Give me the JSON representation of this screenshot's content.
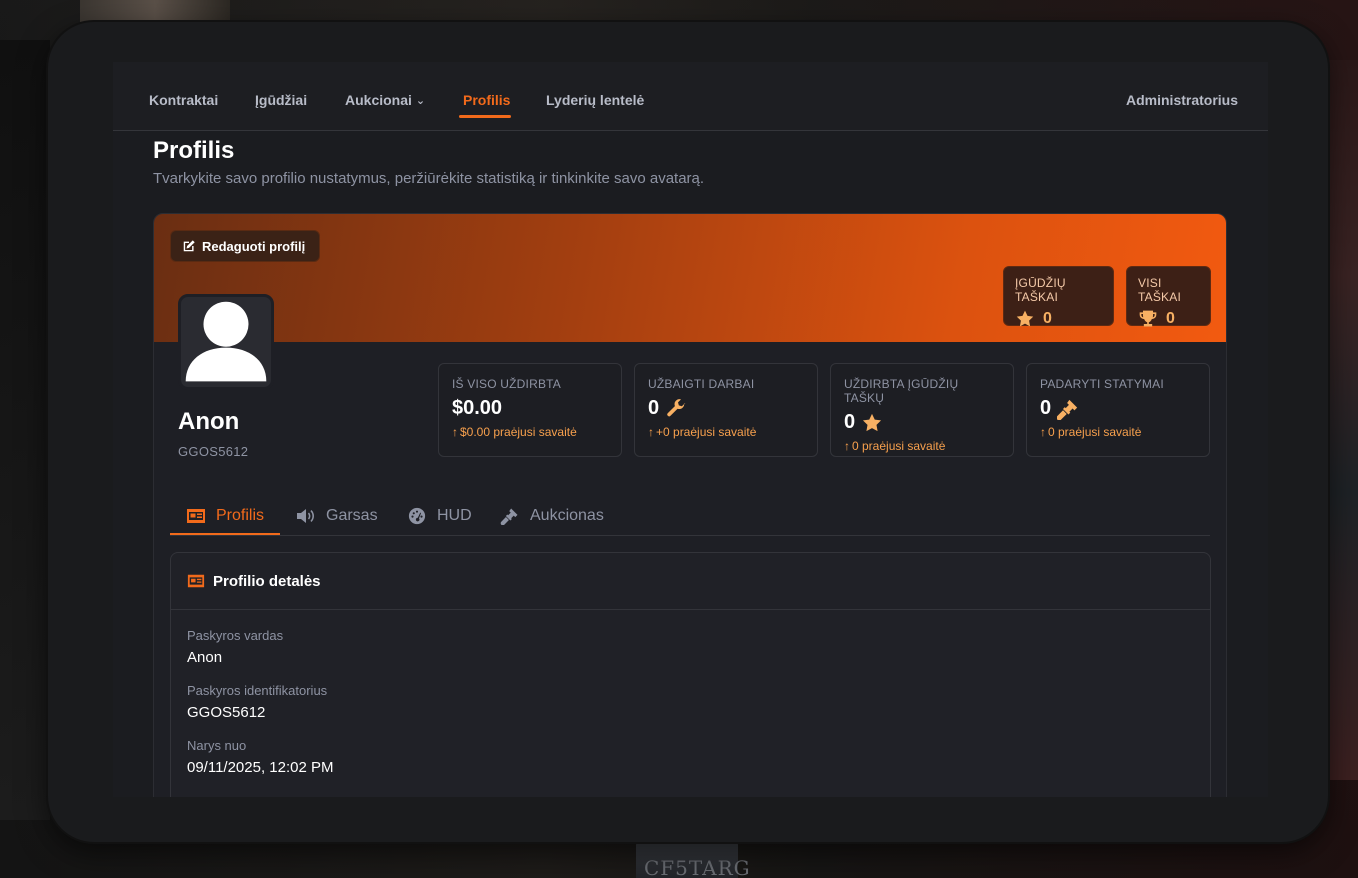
{
  "nav": {
    "items": [
      {
        "label": "Kontraktai"
      },
      {
        "label": "Įgūdžiai"
      },
      {
        "label": "Aukcionai"
      },
      {
        "label": "Profilis"
      },
      {
        "label": "Lyderių lentelė"
      }
    ],
    "active": "Profilis",
    "user_label": "Administratorius"
  },
  "page": {
    "title": "Profilis",
    "subtitle": "Tvarkykite savo profilio nustatymus, peržiūrėkite statistiką ir tinkinkite savo avatarą."
  },
  "profile": {
    "edit_label": "Redaguoti profilį",
    "skill_points": {
      "label": "ĮGŪDŽIŲ TAŠKAI",
      "value": "0",
      "icon": "star-icon"
    },
    "total_points": {
      "label": "VISI TAŠKAI",
      "value": "0",
      "icon": "trophy-icon"
    },
    "name": "Anon",
    "uid": "GGOS5612"
  },
  "stats": [
    {
      "label": "IŠ VISO UŽDIRBTA",
      "value": "$0.00",
      "trend": "$0.00 praėjusi savaitė",
      "icon": ""
    },
    {
      "label": "UŽBAIGTI DARBAI",
      "value": "0",
      "trend": "+0 praėjusi savaitė",
      "icon": "wrench-icon"
    },
    {
      "label": "UŽDIRBTA ĮGŪDŽIŲ TAŠKŲ",
      "value": "0",
      "trend": "0 praėjusi savaitė",
      "icon": "star-icon"
    },
    {
      "label": "PADARYTI STATYMAI",
      "value": "0",
      "trend": "0 praėjusi savaitė",
      "icon": "gavel-icon"
    }
  ],
  "tabs": [
    {
      "label": "Profilis",
      "icon": "id-card-icon"
    },
    {
      "label": "Garsas",
      "icon": "volume-icon"
    },
    {
      "label": "HUD",
      "icon": "gauge-icon"
    },
    {
      "label": "Aukcionas",
      "icon": "gavel-icon"
    }
  ],
  "active_tab": "Profilis",
  "details": {
    "title": "Profilio detalės",
    "fields": [
      {
        "label": "Paskyros vardas",
        "value": "Anon"
      },
      {
        "label": "Paskyros identifikatorius",
        "value": "GGOS5612"
      },
      {
        "label": "Narys nuo",
        "value": "09/11/2025, 12:02 PM"
      }
    ]
  },
  "colors": {
    "accent": "#f26a1b",
    "accent_light": "#f7b063"
  }
}
